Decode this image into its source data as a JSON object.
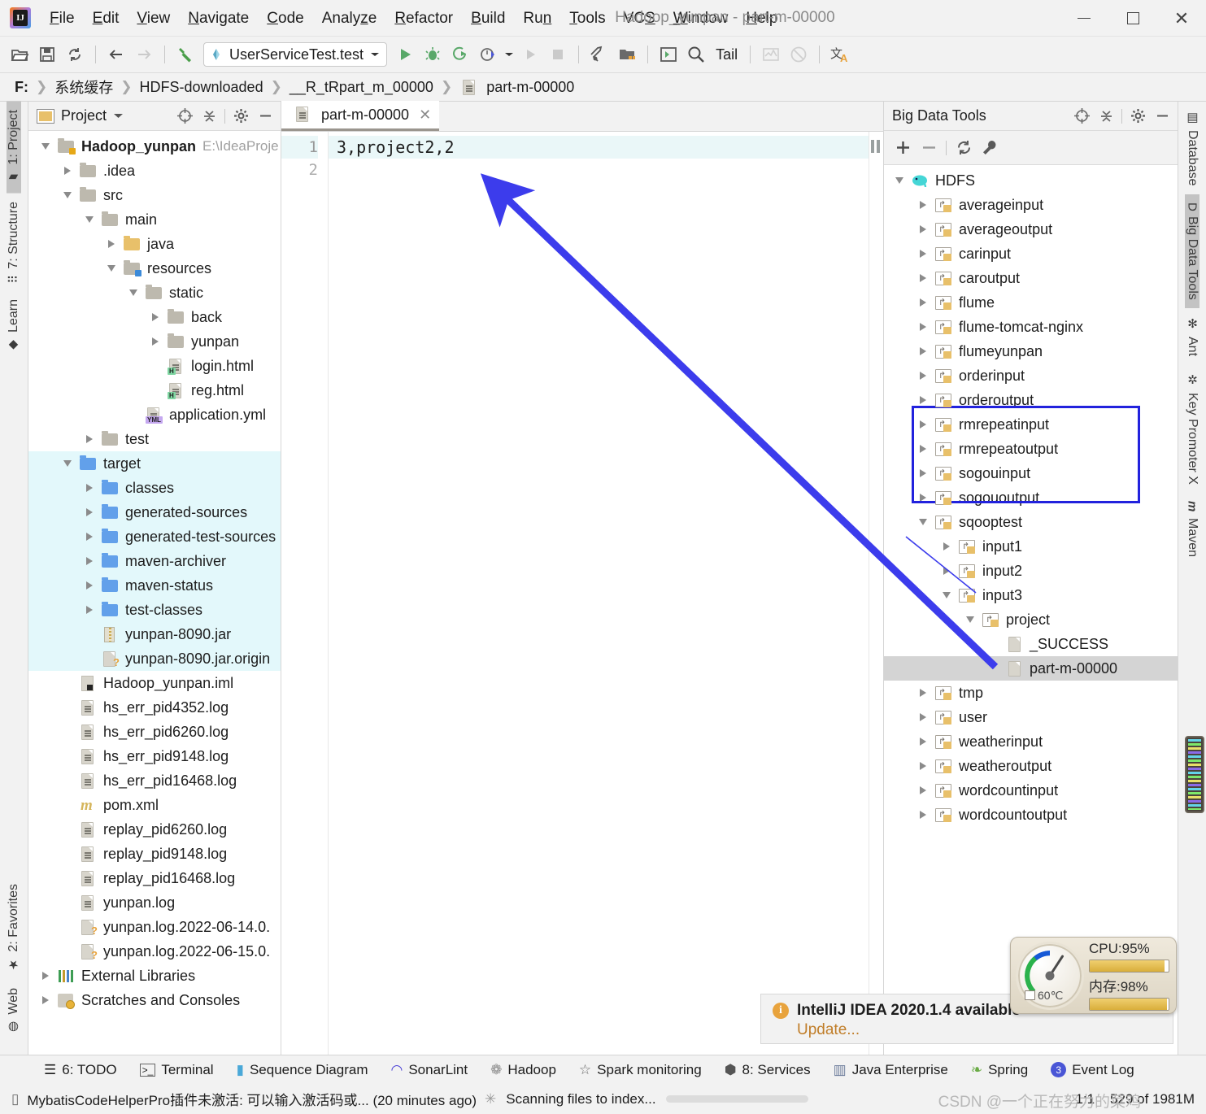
{
  "titlebar": {
    "menus": [
      {
        "label": "File",
        "mnemonic": "F"
      },
      {
        "label": "Edit",
        "mnemonic": "E"
      },
      {
        "label": "View",
        "mnemonic": "V"
      },
      {
        "label": "Navigate",
        "mnemonic": "N"
      },
      {
        "label": "Code",
        "mnemonic": "C"
      },
      {
        "label": "Analyze",
        "mnemonic": "z"
      },
      {
        "label": "Refactor",
        "mnemonic": "R"
      },
      {
        "label": "Build",
        "mnemonic": "B"
      },
      {
        "label": "Run",
        "mnemonic": "n"
      },
      {
        "label": "Tools",
        "mnemonic": "T"
      },
      {
        "label": "VCS",
        "mnemonic": "S"
      },
      {
        "label": "Window",
        "mnemonic": "W"
      },
      {
        "label": "Help",
        "mnemonic": "H"
      }
    ],
    "window_title": "Hadoop_yunpan - part-m-00000",
    "minimize": "minimize",
    "maximize": "maximize",
    "close": "close"
  },
  "toolbar": {
    "open_tip": "Open",
    "save_tip": "Save All",
    "sync_tip": "Synchronize",
    "back_tip": "Back",
    "forward_tip": "Forward",
    "build_tip": "Build Project",
    "run_config": "UserServiceTest.test",
    "run_tip": "Run",
    "debug_tip": "Debug",
    "run_coverage_tip": "Run with Coverage",
    "profile_tip": "Profile",
    "rerun_tip": "Rerun",
    "stop_tip": "Stop",
    "settings_tip": "Settings",
    "project_structure_tip": "Project Structure",
    "tail_label": "Tail",
    "search_tip": "Search Everywhere",
    "console_tip": "Console",
    "chart_tip": "Chart",
    "mute_tip": "Mute Breakpoints",
    "translate_tip": "Translate"
  },
  "breadcrumb": {
    "items": [
      "F:",
      "系统缓存",
      "HDFS-downloaded",
      "__R_tRpart_m_00000",
      "part-m-00000"
    ]
  },
  "left_stripe": {
    "top": [
      {
        "label": "1: Project",
        "mnemonic": "1",
        "icon": "folder-icon",
        "active": true
      },
      {
        "label": "7: Structure",
        "mnemonic": "7",
        "icon": "structure-icon",
        "active": false
      },
      {
        "label": "Learn",
        "icon": "graduation-cap-icon",
        "active": false
      }
    ],
    "bottom": [
      {
        "label": "2: Favorites",
        "mnemonic": "2",
        "icon": "star-icon",
        "active": false
      },
      {
        "label": "Web",
        "icon": "globe-icon",
        "active": false
      }
    ]
  },
  "right_stripe": {
    "items": [
      {
        "label": "Database",
        "icon": "database-icon",
        "active": false
      },
      {
        "label": "Big Data Tools",
        "icon": "bigdata-icon",
        "active": true
      },
      {
        "label": "Ant",
        "icon": "ant-icon",
        "active": false
      },
      {
        "label": "Key Promoter X",
        "icon": "key-icon",
        "active": false
      },
      {
        "label": "Maven",
        "icon": "maven-icon",
        "active": false
      }
    ]
  },
  "project_panel": {
    "title": "Project",
    "dropdown_icon": "chevron-down-icon",
    "locate_icon": "crosshair-icon",
    "collapse_icon": "collapse-all-icon",
    "gear_icon": "gear-icon",
    "hide_icon": "hide-icon",
    "tree": [
      {
        "label": "Hadoop_yunpan",
        "suffix": "E:\\IdeaProje",
        "depth": 0,
        "icon": "module-folder",
        "state": "open",
        "bold": true
      },
      {
        "label": ".idea",
        "depth": 1,
        "icon": "folder-gray",
        "state": "closed"
      },
      {
        "label": "src",
        "depth": 1,
        "icon": "folder-gray",
        "state": "open"
      },
      {
        "label": "main",
        "depth": 2,
        "icon": "folder-gray",
        "state": "open"
      },
      {
        "label": "java",
        "depth": 3,
        "icon": "folder-yellow",
        "state": "closed"
      },
      {
        "label": "resources",
        "depth": 3,
        "icon": "folder-resources",
        "state": "open"
      },
      {
        "label": "static",
        "depth": 4,
        "icon": "folder-gray",
        "state": "open"
      },
      {
        "label": "back",
        "depth": 5,
        "icon": "folder-gray",
        "state": "closed"
      },
      {
        "label": "yunpan",
        "depth": 5,
        "icon": "folder-gray",
        "state": "closed"
      },
      {
        "label": "login.html",
        "depth": 5,
        "icon": "file-html",
        "state": "leaf"
      },
      {
        "label": "reg.html",
        "depth": 5,
        "icon": "file-html",
        "state": "leaf"
      },
      {
        "label": "application.yml",
        "depth": 4,
        "icon": "file-yml",
        "state": "leaf"
      },
      {
        "label": "test",
        "depth": 2,
        "icon": "folder-gray",
        "state": "closed"
      },
      {
        "label": "target",
        "depth": 1,
        "icon": "folder-blue",
        "state": "open",
        "highlight": true
      },
      {
        "label": "classes",
        "depth": 2,
        "icon": "folder-blue",
        "state": "closed",
        "highlight": true
      },
      {
        "label": "generated-sources",
        "depth": 2,
        "icon": "folder-blue",
        "state": "closed",
        "highlight": true
      },
      {
        "label": "generated-test-sources",
        "depth": 2,
        "icon": "folder-blue",
        "state": "closed",
        "highlight": true
      },
      {
        "label": "maven-archiver",
        "depth": 2,
        "icon": "folder-blue",
        "state": "closed",
        "highlight": true
      },
      {
        "label": "maven-status",
        "depth": 2,
        "icon": "folder-blue",
        "state": "closed",
        "highlight": true
      },
      {
        "label": "test-classes",
        "depth": 2,
        "icon": "folder-blue",
        "state": "closed",
        "highlight": true
      },
      {
        "label": "yunpan-8090.jar",
        "depth": 2,
        "icon": "file-jar",
        "state": "leaf",
        "highlight": true
      },
      {
        "label": "yunpan-8090.jar.origin",
        "depth": 2,
        "icon": "file-unknown",
        "state": "leaf",
        "highlight": true
      },
      {
        "label": "Hadoop_yunpan.iml",
        "depth": 1,
        "icon": "file-iml",
        "state": "leaf"
      },
      {
        "label": "hs_err_pid4352.log",
        "depth": 1,
        "icon": "file-text",
        "state": "leaf"
      },
      {
        "label": "hs_err_pid6260.log",
        "depth": 1,
        "icon": "file-text",
        "state": "leaf"
      },
      {
        "label": "hs_err_pid9148.log",
        "depth": 1,
        "icon": "file-text",
        "state": "leaf"
      },
      {
        "label": "hs_err_pid16468.log",
        "depth": 1,
        "icon": "file-text",
        "state": "leaf"
      },
      {
        "label": "pom.xml",
        "depth": 1,
        "icon": "file-maven",
        "state": "leaf"
      },
      {
        "label": "replay_pid6260.log",
        "depth": 1,
        "icon": "file-text",
        "state": "leaf"
      },
      {
        "label": "replay_pid9148.log",
        "depth": 1,
        "icon": "file-text",
        "state": "leaf"
      },
      {
        "label": "replay_pid16468.log",
        "depth": 1,
        "icon": "file-text",
        "state": "leaf"
      },
      {
        "label": "yunpan.log",
        "depth": 1,
        "icon": "file-text",
        "state": "leaf"
      },
      {
        "label": "yunpan.log.2022-06-14.0.",
        "depth": 1,
        "icon": "file-unknown",
        "state": "leaf"
      },
      {
        "label": "yunpan.log.2022-06-15.0.",
        "depth": 1,
        "icon": "file-unknown",
        "state": "leaf"
      },
      {
        "label": "External Libraries",
        "depth": 0,
        "icon": "libraries",
        "state": "closed"
      },
      {
        "label": "Scratches and Consoles",
        "depth": 0,
        "icon": "scratches",
        "state": "closed"
      }
    ]
  },
  "editor": {
    "tab": {
      "label": "part-m-00000",
      "icon": "file-text-icon",
      "close_icon": "close-icon"
    },
    "lines": [
      {
        "number": "1",
        "text": "3,project2,2",
        "current": true
      },
      {
        "number": "2",
        "text": "",
        "current": false
      }
    ]
  },
  "bigdata_panel": {
    "title": "Big Data Tools",
    "locate_icon": "crosshair-icon",
    "collapse_icon": "collapse-all-icon",
    "gear_icon": "gear-icon",
    "hide_icon": "hide-icon",
    "tools": {
      "add_icon": "plus-icon",
      "remove_icon": "minus-icon",
      "refresh_icon": "refresh-icon",
      "wrench_icon": "wrench-icon"
    },
    "tree": [
      {
        "label": "HDFS",
        "depth": 0,
        "icon": "hadoop-elephant",
        "state": "open"
      },
      {
        "label": "averageinput",
        "depth": 1,
        "icon": "hdfs-dir",
        "state": "closed"
      },
      {
        "label": "averageoutput",
        "depth": 1,
        "icon": "hdfs-dir",
        "state": "closed"
      },
      {
        "label": "carinput",
        "depth": 1,
        "icon": "hdfs-dir",
        "state": "closed"
      },
      {
        "label": "caroutput",
        "depth": 1,
        "icon": "hdfs-dir",
        "state": "closed"
      },
      {
        "label": "flume",
        "depth": 1,
        "icon": "hdfs-dir",
        "state": "closed"
      },
      {
        "label": "flume-tomcat-nginx",
        "depth": 1,
        "icon": "hdfs-dir",
        "state": "closed"
      },
      {
        "label": "flumeyunpan",
        "depth": 1,
        "icon": "hdfs-dir",
        "state": "closed"
      },
      {
        "label": "orderinput",
        "depth": 1,
        "icon": "hdfs-dir",
        "state": "closed"
      },
      {
        "label": "orderoutput",
        "depth": 1,
        "icon": "hdfs-dir",
        "state": "closed"
      },
      {
        "label": "rmrepeatinput",
        "depth": 1,
        "icon": "hdfs-dir",
        "state": "closed"
      },
      {
        "label": "rmrepeatoutput",
        "depth": 1,
        "icon": "hdfs-dir",
        "state": "closed"
      },
      {
        "label": "sogouinput",
        "depth": 1,
        "icon": "hdfs-dir",
        "state": "closed"
      },
      {
        "label": "sogououtput",
        "depth": 1,
        "icon": "hdfs-dir",
        "state": "closed"
      },
      {
        "label": "sqooptest",
        "depth": 1,
        "icon": "hdfs-dir",
        "state": "open"
      },
      {
        "label": "input1",
        "depth": 2,
        "icon": "hdfs-dir",
        "state": "closed"
      },
      {
        "label": "input2",
        "depth": 2,
        "icon": "hdfs-dir",
        "state": "closed"
      },
      {
        "label": "input3",
        "depth": 2,
        "icon": "hdfs-dir",
        "state": "open"
      },
      {
        "label": "project",
        "depth": 3,
        "icon": "hdfs-dir",
        "state": "open"
      },
      {
        "label": "_SUCCESS",
        "depth": 4,
        "icon": "hdfs-file",
        "state": "leaf"
      },
      {
        "label": "part-m-00000",
        "depth": 4,
        "icon": "hdfs-file",
        "state": "leaf",
        "selected": true
      },
      {
        "label": "tmp",
        "depth": 1,
        "icon": "hdfs-dir",
        "state": "closed"
      },
      {
        "label": "user",
        "depth": 1,
        "icon": "hdfs-dir",
        "state": "closed"
      },
      {
        "label": "weatherinput",
        "depth": 1,
        "icon": "hdfs-dir",
        "state": "closed"
      },
      {
        "label": "weatheroutput",
        "depth": 1,
        "icon": "hdfs-dir",
        "state": "closed"
      },
      {
        "label": "wordcountinput",
        "depth": 1,
        "icon": "hdfs-dir",
        "state": "closed"
      },
      {
        "label": "wordcountoutput",
        "depth": 1,
        "icon": "hdfs-dir",
        "state": "closed"
      }
    ],
    "highlight_color": "#2222dd"
  },
  "notification": {
    "icon": "info-icon",
    "title": "IntelliJ IDEA 2020.1.4 available",
    "action": "Update..."
  },
  "gauge": {
    "cpu_label": "CPU:95%",
    "cpu_percent": 95,
    "mem_label": "内存:98%",
    "mem_percent": 98,
    "temp_label": "60℃"
  },
  "statusbar": {
    "items": [
      {
        "label": "6: TODO",
        "mnemonic": "6",
        "icon": "todo-icon"
      },
      {
        "label": "Terminal",
        "icon": "terminal-icon"
      },
      {
        "label": "Sequence Diagram",
        "icon": "sequence-diagram-icon"
      },
      {
        "label": "SonarLint",
        "icon": "sonarlint-icon"
      },
      {
        "label": "Hadoop",
        "icon": "hadoop-icon"
      },
      {
        "label": "Spark monitoring",
        "icon": "star-icon"
      },
      {
        "label": "8: Services",
        "mnemonic": "8",
        "icon": "services-icon"
      },
      {
        "label": "Java Enterprise",
        "icon": "java-enterprise-icon"
      },
      {
        "label": "Spring",
        "icon": "spring-leaf-icon"
      },
      {
        "label": "Event Log",
        "icon": "event-log-icon",
        "badge": "3"
      }
    ]
  },
  "bottombar": {
    "plugin_message": "MybatisCodeHelperPro插件未激活: 可以输入激活码或... (20 minutes ago)",
    "plugin_icon": "message-icon",
    "indexing_text": "Scanning files to index...",
    "indexing_icon": "spinner-icon",
    "progress_percent": 100,
    "caret_position": "1:1",
    "memory": "529 of 1981M",
    "watermark": "CSDN @一个正在努力的菜鸡"
  }
}
